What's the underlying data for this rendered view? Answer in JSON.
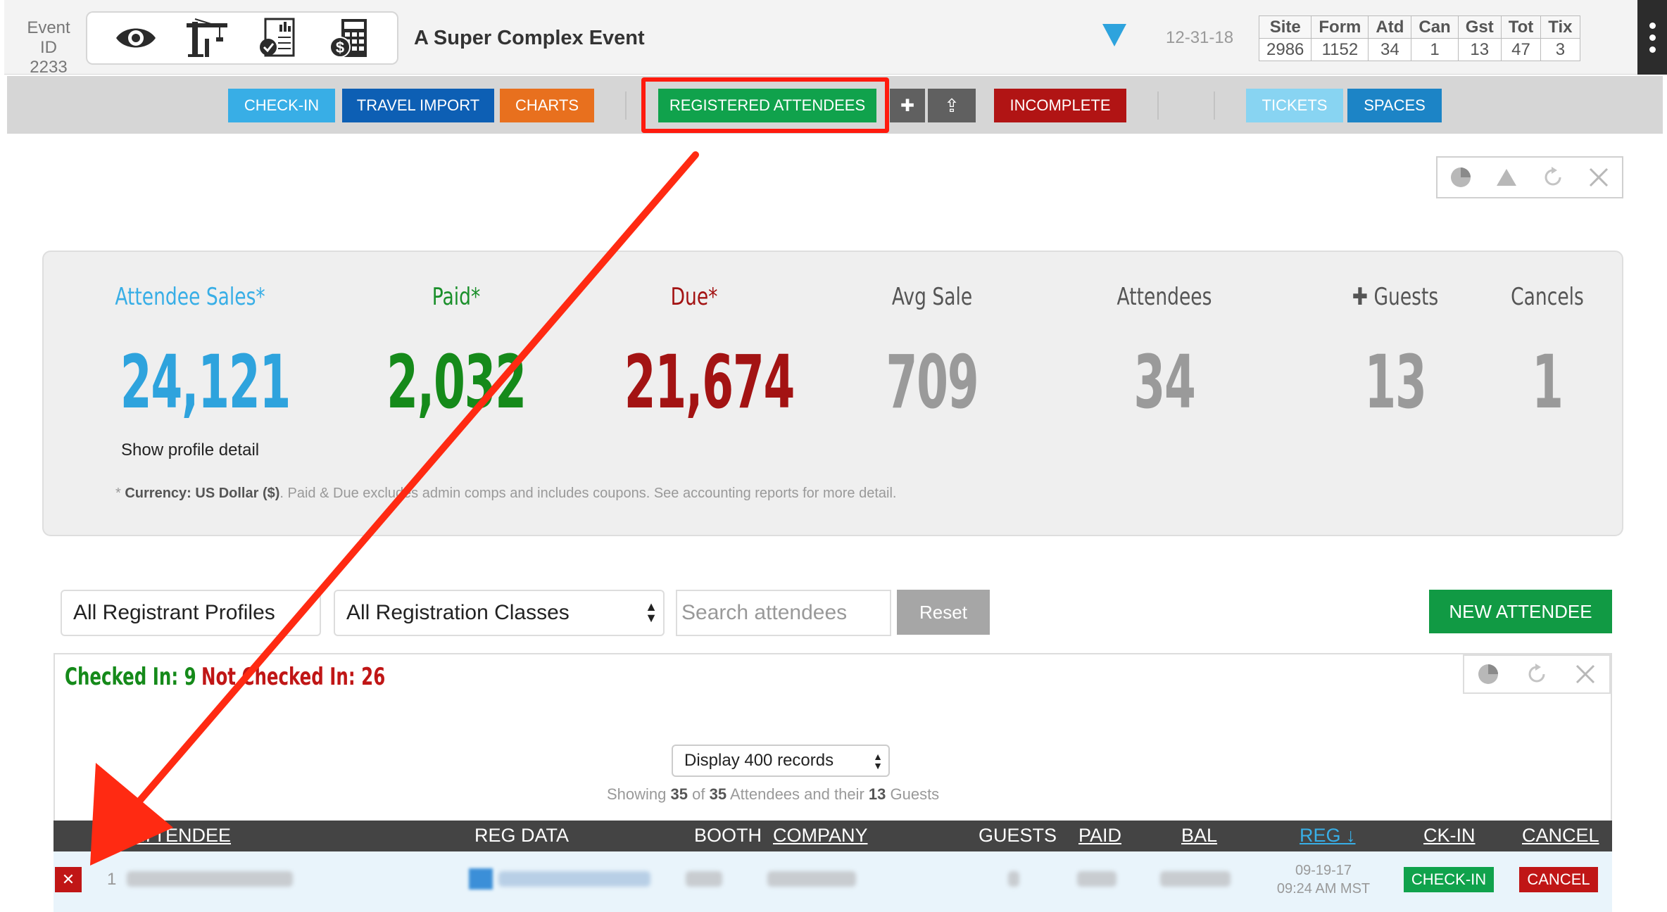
{
  "header": {
    "event_id_label": "Event ID",
    "event_id": "2233",
    "icons": [
      "eye-icon",
      "crane-icon",
      "report-icon",
      "calculator-icon"
    ],
    "title": "A Super Complex Event",
    "date": "12-31-18",
    "stats": {
      "headers": [
        "Site",
        "Form",
        "Atd",
        "Can",
        "Gst",
        "Tot",
        "Tix"
      ],
      "values": [
        "2986",
        "1152",
        "34",
        "1",
        "13",
        "47",
        "3"
      ]
    }
  },
  "nav": {
    "checkin": "CHECK-IN",
    "travel_import": "TRAVEL IMPORT",
    "charts": "CHARTS",
    "registered_attendees": "REGISTERED ATTENDEES",
    "plus": "✚",
    "upload": "⇪",
    "incomplete": "INCOMPLETE",
    "tickets": "TICKETS",
    "spaces": "SPACES"
  },
  "colors": {
    "checkin": "#38aee6",
    "travel_import": "#0d5fb4",
    "charts": "#e8701e",
    "registered_attendees": "#10a24c",
    "plus": "#606060",
    "incomplete": "#b11414",
    "tickets": "#88d4f2",
    "spaces": "#1c84c6",
    "highlight": "#ff1a0d"
  },
  "summary": {
    "attendee_sales_label": "Attendee Sales*",
    "attendee_sales": "24,121",
    "paid_label": "Paid*",
    "paid": "2,032",
    "due_label": "Due*",
    "due": "21,674",
    "avg_sale_label": "Avg Sale",
    "avg_sale": "709",
    "attendees_label": "Attendees",
    "attendees": "34",
    "guests_label": "✚ Guests",
    "guests": "13",
    "cancels_label": "Cancels",
    "cancels": "1",
    "show_profile": "Show profile detail",
    "currency_prefix": "* ",
    "currency_bold": "Currency: US Dollar ($)",
    "currency_rest": ". Paid & Due excludes admin comps and includes coupons. See accounting reports for more detail."
  },
  "filters": {
    "profiles": "All Registrant Profiles",
    "classes": "All Registration Classes",
    "search_placeholder": "Search attendees",
    "reset": "Reset",
    "new_attendee": "NEW ATTENDEE"
  },
  "list": {
    "checked_in": "Checked In: 9",
    "not_checked_in": "Not Checked In: 26",
    "display": "Display 400 records",
    "showing_prefix": "Showing ",
    "showing_count": "35",
    "showing_of": " of ",
    "showing_total": "35",
    "showing_mid": " Attendees and their ",
    "showing_guests": "13",
    "showing_suffix": " Guests",
    "columns": {
      "attendee": "ATTENDEE",
      "reg_data": "REG DATA",
      "booth": "BOOTH",
      "company": "COMPANY",
      "guests": "GUESTS",
      "paid": "PAID",
      "bal": "BAL",
      "reg": "REG ↓",
      "ckin": "CK-IN",
      "cancel": "CANCEL"
    },
    "row": {
      "delete": "✕",
      "number": "1",
      "reg_date": "09-19-17",
      "reg_time": "09:24 AM MST",
      "checkin_button": "CHECK-IN",
      "cancel_button": "CANCEL"
    }
  }
}
